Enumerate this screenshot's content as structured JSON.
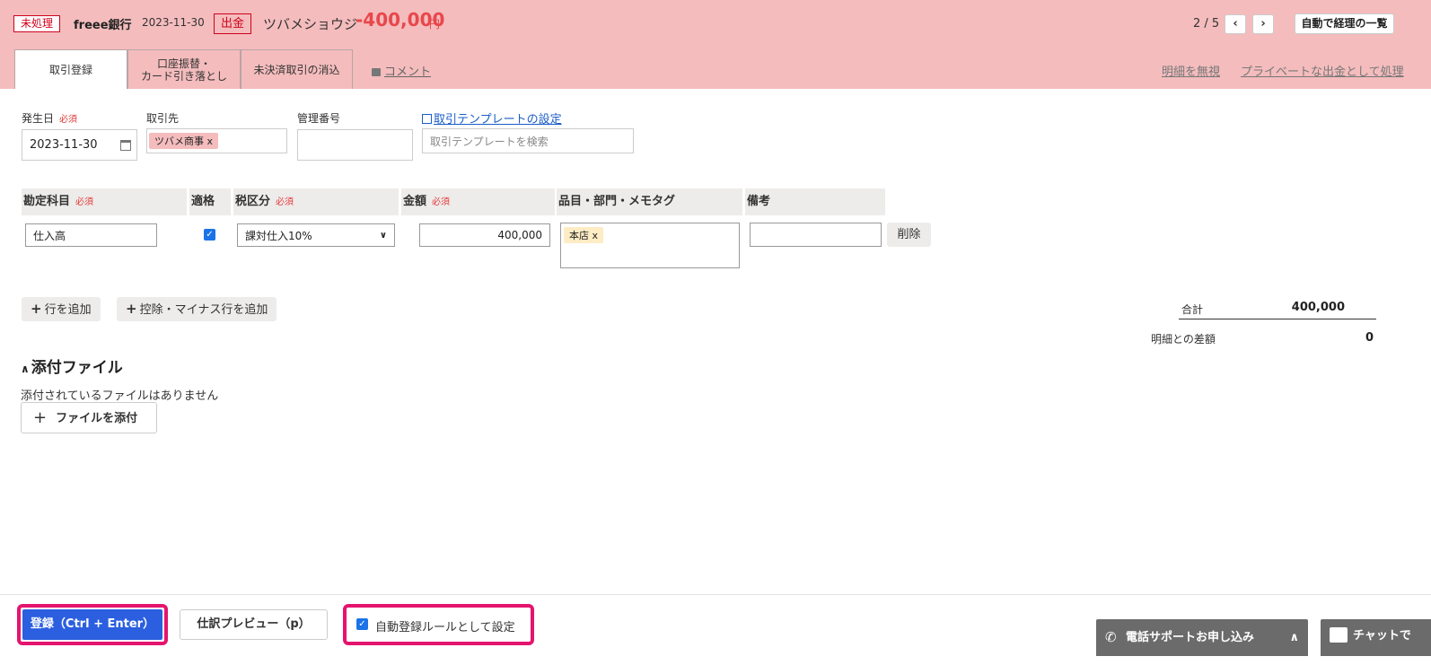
{
  "header": {
    "status": "未処理",
    "bank": "freee銀行",
    "date": "2023-11-30",
    "direction": "出金",
    "partner": "ツバメショウジ",
    "amount": "-400,000",
    "currency": "円",
    "pager": "2 / 5",
    "prev_icon": "‹",
    "next_icon": "›",
    "list_button": "自動で経理の一覧"
  },
  "tabs": [
    {
      "label": "取引登録",
      "active": true
    },
    {
      "label_line1": "口座振替・",
      "label_line2": "カード引き落とし"
    },
    {
      "label": "未決済取引の消込"
    }
  ],
  "links": {
    "comment": "コメント",
    "ignore": "明細を無視",
    "private": "プライベートな出金として処理",
    "template_setting": "取引テンプレートの設定"
  },
  "form": {
    "date_label": "発生日",
    "required": "必須",
    "date_value": "2023-11-30",
    "partner_label": "取引先",
    "partner_tag": "ツバメ商事",
    "tag_remove": "x",
    "control_no_label": "管理番号",
    "control_no_value": "",
    "template_placeholder": "取引テンプレートを検索"
  },
  "table": {
    "headers": {
      "account": "勘定科目",
      "qualified": "適格",
      "tax": "税区分",
      "amount": "金額",
      "item": "品目・部門・メモタグ",
      "note": "備考"
    },
    "rows": [
      {
        "account": "仕入高",
        "qualified": true,
        "tax": "課対仕入10%",
        "amount": "400,000",
        "item_tag": "本店",
        "note": "",
        "delete": "削除"
      }
    ]
  },
  "actions": {
    "add_row": "行を追加",
    "add_minus_row": "控除・マイナス行を追加"
  },
  "totals": {
    "total_label": "合計",
    "total_value": "400,000",
    "diff_label": "明細との差額",
    "diff_value": "0"
  },
  "attachments": {
    "title": "添付ファイル",
    "empty": "添付されているファイルはありません",
    "add_button": "ファイルを添付"
  },
  "footer": {
    "register": "登録（Ctrl + Enter）",
    "preview": "仕訳プレビュー（p）",
    "rule_checkbox": "自動登録ルールとして設定",
    "rule_checked": true,
    "phone_support": "電話サポートお申し込み",
    "chat": "チャットで"
  },
  "colors": {
    "header_bg": "#f4bcbd",
    "accent_red": "#e8474b",
    "primary_blue": "#2b5fe0",
    "highlight": "#e5146e"
  }
}
